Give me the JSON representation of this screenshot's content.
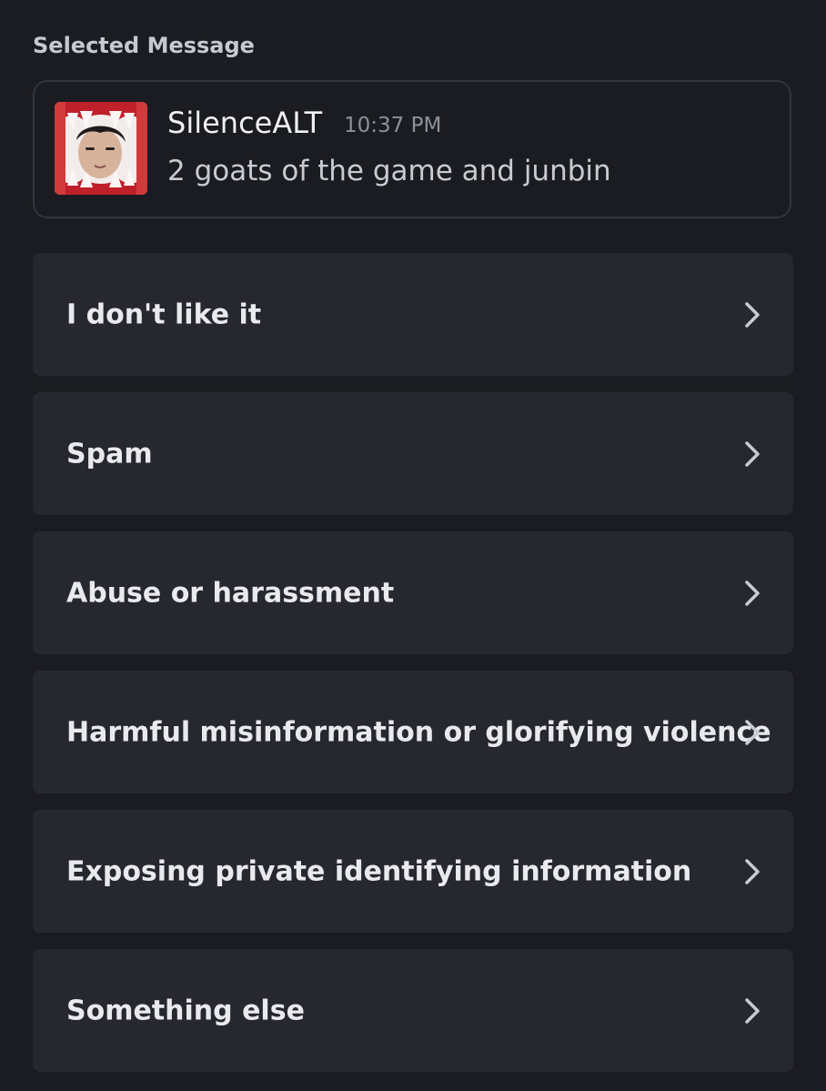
{
  "section": {
    "label": "Selected Message"
  },
  "message": {
    "author": "SilenceALT",
    "time": "10:37 PM",
    "text": "2 goats of the game and junbin"
  },
  "options": [
    {
      "label": "I don't like it",
      "icon": "chevron-right-icon"
    },
    {
      "label": "Spam",
      "icon": "chevron-right-icon"
    },
    {
      "label": "Abuse or harassment",
      "icon": "chevron-right-icon"
    },
    {
      "label": "Harmful misinformation or glorifying violence",
      "icon": "chevron-right-icon"
    },
    {
      "label": "Exposing private identifying information",
      "icon": "chevron-right-icon"
    },
    {
      "label": "Something else",
      "icon": "chevron-right-icon"
    }
  ],
  "colors": {
    "background": "#1b1c21",
    "card_border": "#33353c",
    "option_background": "#26272f",
    "text_primary": "#e9eaee",
    "text_muted": "#8e9099",
    "avatar_frame": "#c0202a"
  }
}
